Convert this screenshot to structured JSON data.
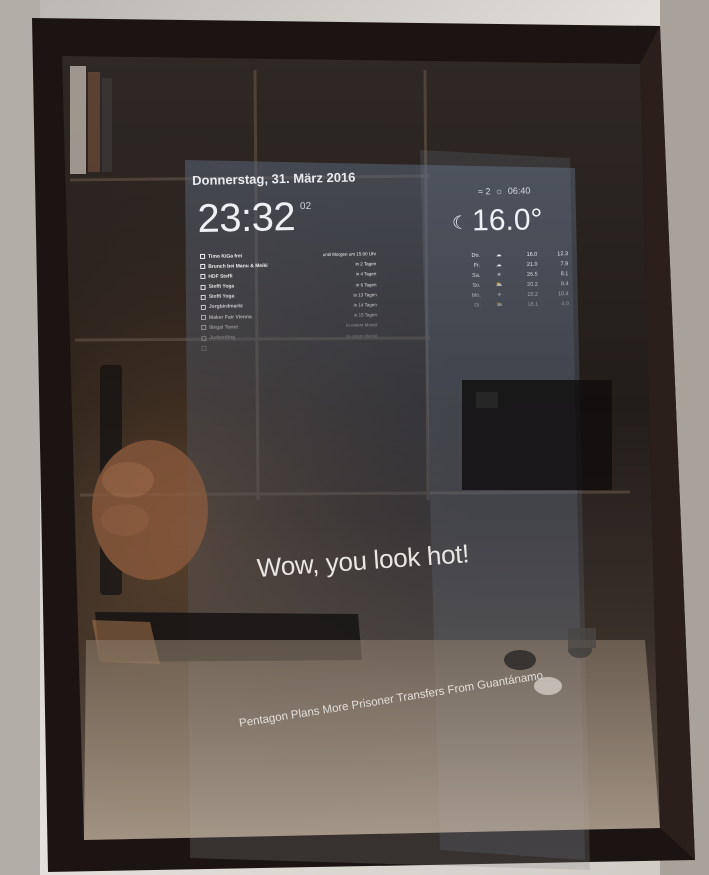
{
  "mirror": {
    "date": "Donnerstag, 31. März 2016",
    "clock_time": "23:32",
    "clock_seconds": "02",
    "calendar": [
      {
        "title": "Timo KiGa frei",
        "when": "until Morgen um 15:00 Uhr"
      },
      {
        "title": "Brunch bei Manu & Meiki",
        "when": "in 2 Tagen"
      },
      {
        "title": "HDF Steffi",
        "when": "in 4 Tagen"
      },
      {
        "title": "Steffi Yoga",
        "when": "in 6 Tagen"
      },
      {
        "title": "Steffi Yoga",
        "when": "in 13 Tagen"
      },
      {
        "title": "Jorgbirdmarkt",
        "when": "in 14 Tagen"
      },
      {
        "title": "Maker Fair Vienna",
        "when": "in 15 Tagen"
      },
      {
        "title": "Illegal Tonet",
        "when": "in einem Monat"
      },
      {
        "title": "Jurbenfing",
        "when": "in einem Monat"
      },
      {
        "title": "",
        "when": ""
      }
    ],
    "weather_wind": "2",
    "weather_sunrise": "06:40",
    "temperature_now": "16.0°",
    "forecast": [
      {
        "day": "Do.",
        "max": "16.0",
        "min": "12.3"
      },
      {
        "day": "Fr.",
        "max": "21.0",
        "min": "7.9"
      },
      {
        "day": "Sa.",
        "max": "26.5",
        "min": "8.1"
      },
      {
        "day": "So.",
        "max": "20.2",
        "min": "9.4"
      },
      {
        "day": "Mo.",
        "max": "15.2",
        "min": "10.4"
      },
      {
        "day": "Di.",
        "max": "18.1",
        "min": "4.0"
      }
    ],
    "compliment": "Wow, you look hot!",
    "news_headline": "Pentagon Plans More Prisoner Transfers From Guantánamo"
  },
  "icons": {
    "calendar": "calendar-icon",
    "wind": "wind-icon",
    "sunrise": "sunrise-icon",
    "moon": "moon-icon",
    "forecast": [
      "cloud-icon",
      "cloud-icon",
      "sun-icon",
      "partly-cloudy-icon",
      "sun-icon",
      "partly-cloudy-icon"
    ]
  }
}
